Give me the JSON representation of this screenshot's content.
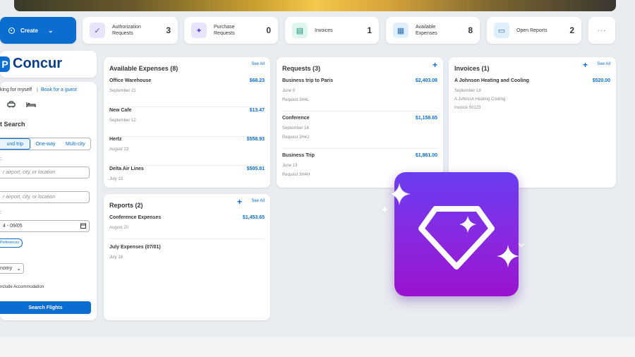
{
  "colors": {
    "accent": "#0a6ed1",
    "icon_gradient_top": "#6a3df0",
    "icon_gradient_bottom": "#9a12d0"
  },
  "create_button": {
    "label": "Create",
    "icon": "globe-icon",
    "chevron": "chevron-down-icon"
  },
  "stats": [
    {
      "label": "Authorization Requests",
      "count": "3",
      "icon": "check-icon",
      "icon_bg": "#e8e4fb",
      "icon_color": "#5b4ccf"
    },
    {
      "label": "Purchase Requests",
      "count": "0",
      "icon": "tag-icon",
      "icon_bg": "#e8e4fb",
      "icon_color": "#5b4ccf"
    },
    {
      "label": "Invoices",
      "count": "1",
      "icon": "invoice-icon",
      "icon_bg": "#dff5ef",
      "icon_color": "#188c6b"
    },
    {
      "label": "Available Expenses",
      "count": "8",
      "icon": "receipt-icon",
      "icon_bg": "#e0effc",
      "icon_color": "#2b6cb0"
    },
    {
      "label": "Open Reports",
      "count": "2",
      "icon": "folder-icon",
      "icon_bg": "#e0effc",
      "icon_color": "#2b6cb0"
    }
  ],
  "more_label": "···",
  "logo": {
    "mark": "P",
    "text": "Concur"
  },
  "travel": {
    "booking_for": "king for myself",
    "separator": "|",
    "book_guest": "Book for a guest",
    "search_title": "t Search",
    "trip_types": [
      "und trip",
      "One-way",
      "Multi-city"
    ],
    "from_placeholder": "r airport, city, or location",
    "to_placeholder": "r airport, city, or location",
    "dates": "4 - 09/05",
    "preferences": "Preferences",
    "cabin": "nomy",
    "include_accommodation": "nclude Accommodation",
    "search_button": "Search Flights"
  },
  "available_expenses": {
    "title": "Available Expenses (8)",
    "see_all": "See All",
    "items": [
      {
        "name": "Office Warehouse",
        "amount": "$68.23",
        "date": "September 21"
      },
      {
        "name": "New Cafe",
        "amount": "$13.47",
        "date": "September 12"
      },
      {
        "name": "Hertz",
        "amount": "$558.93",
        "date": "August 13"
      },
      {
        "name": "Delta Air Lines",
        "amount": "$505.81",
        "date": "July 13"
      }
    ]
  },
  "reports": {
    "title": "Reports (2)",
    "see_all": "See All",
    "items": [
      {
        "name": "Conference Expenses",
        "amount": "$1,453.65",
        "date": "August 20"
      },
      {
        "name": "July Expenses (07/01)",
        "amount": "",
        "date": "July 16"
      }
    ]
  },
  "requests": {
    "title": "Requests (3)",
    "items": [
      {
        "name": "Business trip to Paris",
        "amount": "$2,403.08",
        "date": "June 9",
        "id": "Request 3H4L"
      },
      {
        "name": "Conference",
        "amount": "$1,158.65",
        "date": "September 24",
        "id": "Request 3H4J"
      },
      {
        "name": "Business Trip",
        "amount": "$1,861.00",
        "date": "June 13",
        "id": "Request 3H4H"
      }
    ]
  },
  "invoices": {
    "title": "Invoices (1)",
    "see_all": "See All",
    "items": [
      {
        "name": "A Johnson Heating and Cooling",
        "amount": "$520.00",
        "date": "September 18",
        "vendor": "A Johnson Heating Cooling",
        "id": "Invoice 50123"
      }
    ]
  }
}
